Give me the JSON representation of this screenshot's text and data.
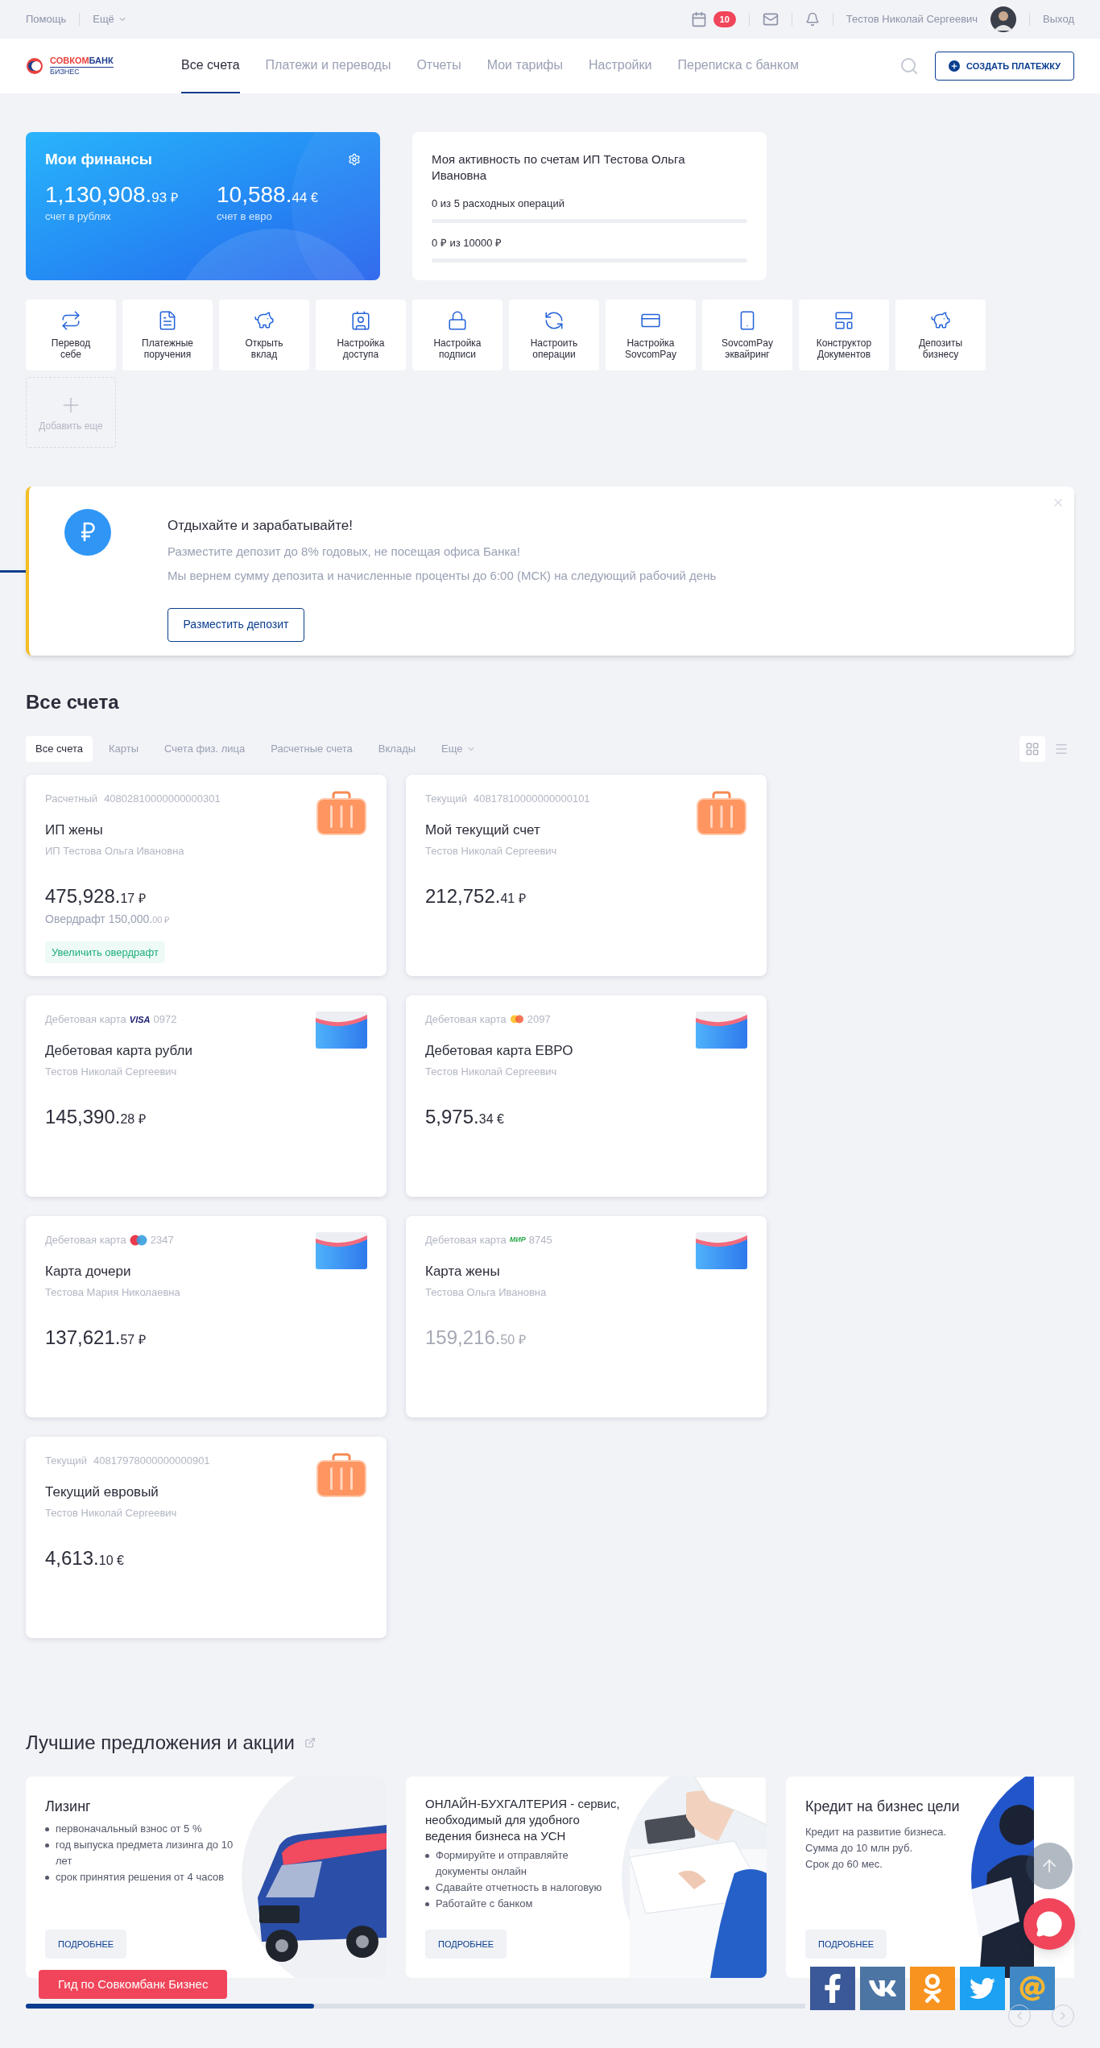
{
  "top_bar": {
    "left_links": [
      {
        "label": "Помощь",
        "dropdown": false
      },
      {
        "label": "Ещё",
        "dropdown": true
      }
    ],
    "calendar_badge": "10",
    "user_name": "Тестов Николай Сергеевич",
    "logout": "Выход"
  },
  "logo": {
    "line1_red": "СОВКОМ",
    "line1_blue": "БАНК",
    "line2": "БИЗНЕС"
  },
  "nav": {
    "tabs": [
      {
        "label": "Все счета",
        "selected": true
      },
      {
        "label": "Платежи и переводы",
        "selected": false
      },
      {
        "label": "Отчеты",
        "selected": false
      },
      {
        "label": "Мои тарифы",
        "selected": false
      },
      {
        "label": "Настройки",
        "selected": false
      },
      {
        "label": "Переписка с банком",
        "selected": false
      }
    ],
    "create_button": "СОЗДАТЬ ПЛАТЕЖКУ"
  },
  "finances": {
    "title": "Мои финансы",
    "totals": [
      {
        "whole": "1,130,908.",
        "fraction": "93",
        "currency": "₽",
        "caption": "счет в рублях"
      },
      {
        "whole": "10,588.",
        "fraction": "44",
        "currency": "€",
        "caption": "счет в евро"
      }
    ]
  },
  "activity": {
    "title": "Моя активность по счетам ИП Тестова Ольга Ивановна",
    "meters": [
      {
        "label": "0 из 5 расходных операций",
        "level": 0
      },
      {
        "label": "0 ₽ из 10000 ₽",
        "level": 0
      }
    ]
  },
  "quick_actions": [
    {
      "kind": "action",
      "label": "Перевод себе"
    },
    {
      "kind": "action",
      "label": "Платежные поручения"
    },
    {
      "kind": "action",
      "label": "Открыть вклад"
    },
    {
      "kind": "action",
      "label": "Настройка доступа"
    },
    {
      "kind": "action",
      "label": "Настройка подписи"
    },
    {
      "kind": "action",
      "label": "Настроить операции"
    },
    {
      "kind": "action",
      "label": "Настройка SovcomPay"
    },
    {
      "kind": "action",
      "label": "SovcomPay эквайринг"
    },
    {
      "kind": "action",
      "label": "Конструктор Документов"
    },
    {
      "kind": "action",
      "label": "Депозиты бизнесу"
    },
    {
      "kind": "add",
      "label": "Добавить еще"
    }
  ],
  "promo_banner": {
    "title": "Отдыхайте и зарабатывайте!",
    "lines": [
      "Разместите депозит до 8% годовых, не посещая офиса Банка!",
      "Мы вернем сумму депозита и начисленные проценты до 6:00 (МСК) на следующий рабочий день"
    ],
    "button": "Разместить депозит"
  },
  "accounts": {
    "title": "Все счета",
    "filters": [
      {
        "label": "Все счета",
        "selected": true,
        "dropdown": false
      },
      {
        "label": "Карты",
        "selected": false,
        "dropdown": false
      },
      {
        "label": "Счета физ. лица",
        "selected": false,
        "dropdown": false
      },
      {
        "label": "Расчетные счета",
        "selected": false,
        "dropdown": false
      },
      {
        "label": "Вклады",
        "selected": false,
        "dropdown": false
      },
      {
        "label": "Еще",
        "selected": false,
        "dropdown": true
      }
    ],
    "view_modes": [
      {
        "kind": "grid",
        "selected": true
      },
      {
        "kind": "list",
        "selected": false
      }
    ],
    "items": [
      {
        "kind": "account",
        "type": "Расчетный",
        "number": "40802810000000000301",
        "name": "ИП жены",
        "owner": "ИП Тестова Ольга Ивановна",
        "whole": "475,928.",
        "fraction": "17",
        "currency": "₽",
        "muted": false,
        "overdraft": {
          "label": "Овердрафт 150,000.",
          "fraction": "00",
          "currency": "₽"
        },
        "action": "Увеличить овердрафт"
      },
      {
        "kind": "account",
        "type": "Текущий",
        "number": "40817810000000000101",
        "name": "Мой текущий счет",
        "owner": "Тестов Николай Сергеевич",
        "whole": "212,752.",
        "fraction": "41",
        "currency": "₽",
        "muted": false
      },
      {
        "kind": "card",
        "type": "Дебетовая карта",
        "network": {
          "kind": "visa",
          "label": "VISA"
        },
        "number": "0972",
        "name": "Дебетовая карта рубли",
        "owner": "Тестов Николай Сергеевич",
        "whole": "145,390.",
        "fraction": "28",
        "currency": "₽",
        "muted": false
      },
      {
        "kind": "card",
        "type": "Дебетовая карта",
        "network": {
          "kind": "mastercard"
        },
        "number": "2097",
        "name": "Дебетовая карта ЕВРО",
        "owner": "Тестов Николай Сергеевич",
        "whole": "5,975.",
        "fraction": "34",
        "currency": "€",
        "muted": false
      },
      {
        "kind": "card",
        "type": "Дебетовая карта",
        "network": {
          "kind": "maestro"
        },
        "number": "2347",
        "name": "Карта дочери",
        "owner": "Тестова Мария Николаевна",
        "whole": "137,621.",
        "fraction": "57",
        "currency": "₽",
        "muted": false
      },
      {
        "kind": "card",
        "type": "Дебетовая карта",
        "network": {
          "kind": "mir",
          "label": "МИР"
        },
        "number": "8745",
        "name": "Карта жены",
        "owner": "Тестова Ольга Ивановна",
        "whole": "159,216.",
        "fraction": "50",
        "currency": "₽",
        "muted": true
      },
      {
        "kind": "account",
        "type": "Текущий",
        "number": "40817978000000000901",
        "name": "Текущий евровый",
        "owner": "Тестов Николай Сергеевич",
        "whole": "4,613.",
        "fraction": "10",
        "currency": "€",
        "muted": false
      }
    ]
  },
  "offers": {
    "title": "Лучшие предложения и акции",
    "items": [
      {
        "title": "Лизинг",
        "bullets": [
          "первоначальный взнос от 5 %",
          "год выпуска предмета лизинга до 10 лет",
          "срок принятия решения от 4 часов"
        ],
        "button": "ПОДРОБНЕЕ"
      },
      {
        "title": "ОНЛАЙН-БУХГАЛТЕРИЯ - сервис, необходимый для удобного ведения бизнеса на УСН",
        "bullets": [
          "Формируйте и отправляйте документы онлайн",
          "Сдавайте отчетность в налоговую",
          "Работайте с банком"
        ],
        "button": "ПОДРОБНЕЕ"
      },
      {
        "title": "Кредит на бизнес цели",
        "lines": [
          "Кредит на развитие бизнеса.",
          "Сумма до 10 млн руб.",
          "Срок до 60 мес."
        ],
        "button": "ПОДРОБНЕЕ"
      }
    ],
    "carousel": {
      "level": 0.37
    }
  },
  "guide_button": "Гид по Совкомбанк Бизнес"
}
